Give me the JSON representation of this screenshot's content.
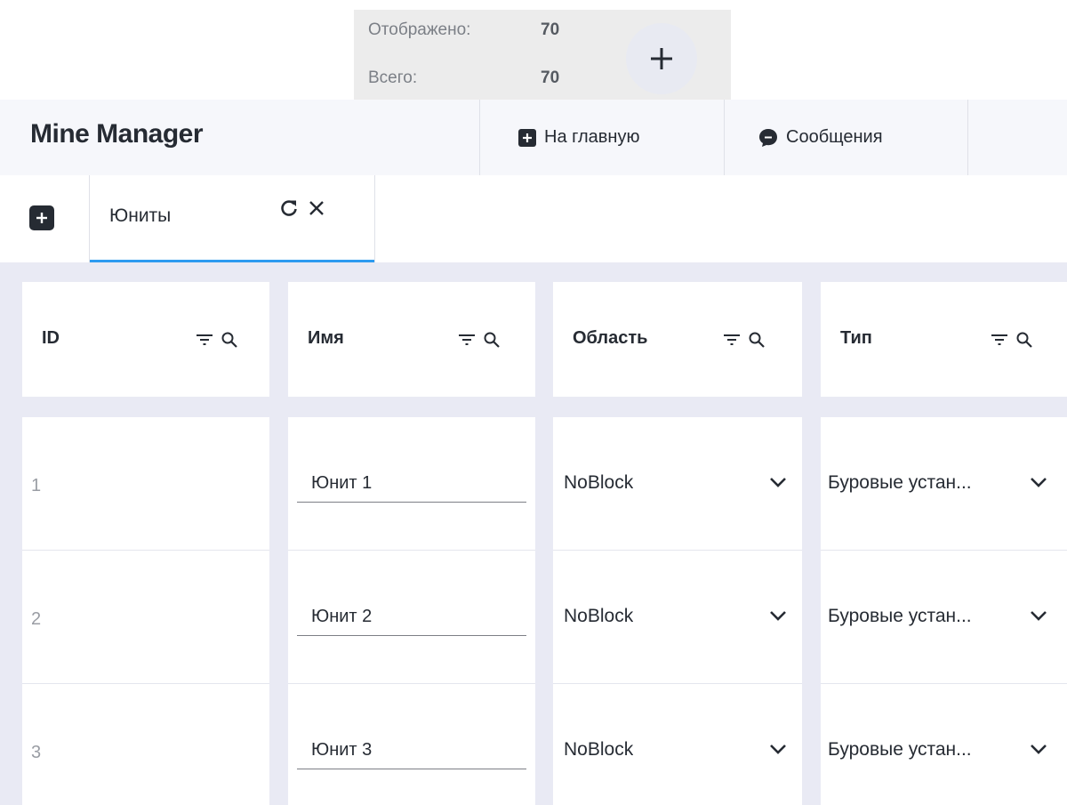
{
  "counter": {
    "shown_label": "Отображено:",
    "shown_value": "70",
    "total_label": "Всего:",
    "total_value": "70"
  },
  "header": {
    "title": "Mine Manager",
    "home_label": "На главную",
    "messages_label": "Сообщения"
  },
  "tabs": [
    {
      "label": "Юниты",
      "active": true
    }
  ],
  "table": {
    "columns": [
      {
        "label": "ID"
      },
      {
        "label": "Имя"
      },
      {
        "label": "Область"
      },
      {
        "label": "Тип"
      }
    ],
    "rows": [
      {
        "id": "1",
        "name": "Юнит 1",
        "area": "NoBlock",
        "type": "Буровые устан..."
      },
      {
        "id": "2",
        "name": "Юнит 2",
        "area": "NoBlock",
        "type": "Буровые устан..."
      },
      {
        "id": "3",
        "name": "Юнит 3",
        "area": "NoBlock",
        "type": "Буровые устан..."
      }
    ]
  },
  "colors": {
    "accent": "#2d9bf0",
    "grid_background": "#e9eaf4",
    "header_background": "#f6f7fb",
    "dark": "#262b33"
  },
  "icons": {
    "counter_add": "plus-icon",
    "home": "plus-square-icon",
    "messages": "chat-bubble-icon",
    "tab_add": "plus-square-icon",
    "tab_refresh": "refresh-icon",
    "tab_close": "close-icon",
    "column_filter": "filter-icon",
    "column_search": "search-icon",
    "select_open": "chevron-down-icon"
  }
}
